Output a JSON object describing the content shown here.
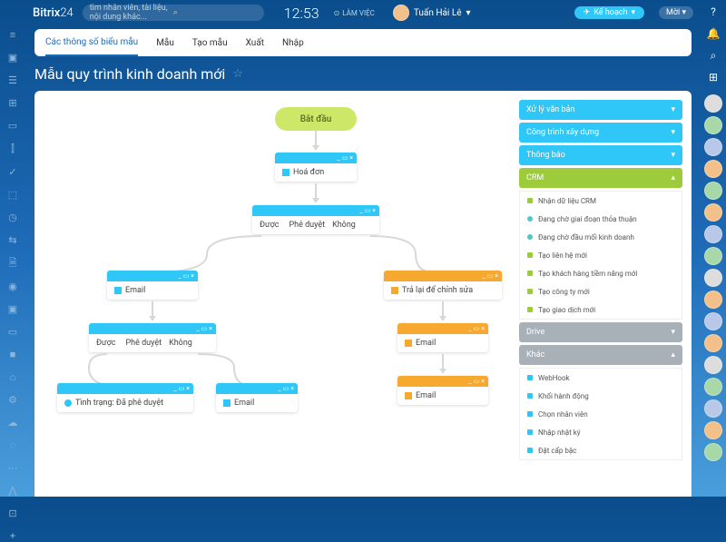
{
  "logo": {
    "brand": "Bitrix",
    "suffix": "24"
  },
  "search": {
    "placeholder": "tìm nhân viên, tài liệu, nội dung khác..."
  },
  "clock": "12:53",
  "work_button": "LÀM VIỆC",
  "user_name": "Tuấn Hải Lê",
  "plan_button": "Kế hoạch",
  "invite_button": "Mời",
  "tabs": [
    "Các thông số biểu mẫu",
    "Mẫu",
    "Tạo mẫu",
    "Xuất",
    "Nhập"
  ],
  "page_title": "Mẫu quy trình kinh doanh mới",
  "flow": {
    "start": "Bắt đầu",
    "invoice": "Hoá đơn",
    "approve1": {
      "yes": "Được",
      "label": "Phê duyệt",
      "no": "Không"
    },
    "email1": "Email",
    "return_edit": "Trả lại để chỉnh sửa",
    "approve2": {
      "yes": "Được",
      "label": "Phê duyệt",
      "no": "Không"
    },
    "email2": "Email",
    "status": "Tình trạng: Đã phê duyệt",
    "email3": "Email",
    "email4": "Email"
  },
  "panel": {
    "sections": [
      {
        "label": "Xử lý văn bản",
        "style": "blue",
        "open": false
      },
      {
        "label": "Công trình xây dựng",
        "style": "blue",
        "open": false
      },
      {
        "label": "Thông báo",
        "style": "blue",
        "open": false
      },
      {
        "label": "CRM",
        "style": "green",
        "open": true,
        "items": [
          {
            "dot": "green",
            "text": "Nhận dữ liệu CRM"
          },
          {
            "dot": "teal",
            "text": "Đang chờ giai đoạn thỏa thuận"
          },
          {
            "dot": "teal",
            "text": "Đang chờ đầu mối kinh doanh"
          },
          {
            "dot": "green",
            "text": "Tạo liên hệ mới"
          },
          {
            "dot": "green",
            "text": "Tạo khách hàng tiềm năng mới"
          },
          {
            "dot": "green",
            "text": "Tạo công ty mới"
          },
          {
            "dot": "green",
            "text": "Tạo giao dịch mới"
          }
        ]
      },
      {
        "label": "Drive",
        "style": "gray",
        "open": false
      },
      {
        "label": "Khác",
        "style": "gray",
        "open": true,
        "items": [
          {
            "dot": "blue",
            "text": "WebHook"
          },
          {
            "dot": "blue",
            "text": "Khối hành động"
          },
          {
            "dot": "blue",
            "text": "Chọn nhân viên"
          },
          {
            "dot": "blue",
            "text": "Nhập nhật ký"
          },
          {
            "dot": "blue",
            "text": "Đặt cấp bậc"
          }
        ]
      }
    ]
  }
}
